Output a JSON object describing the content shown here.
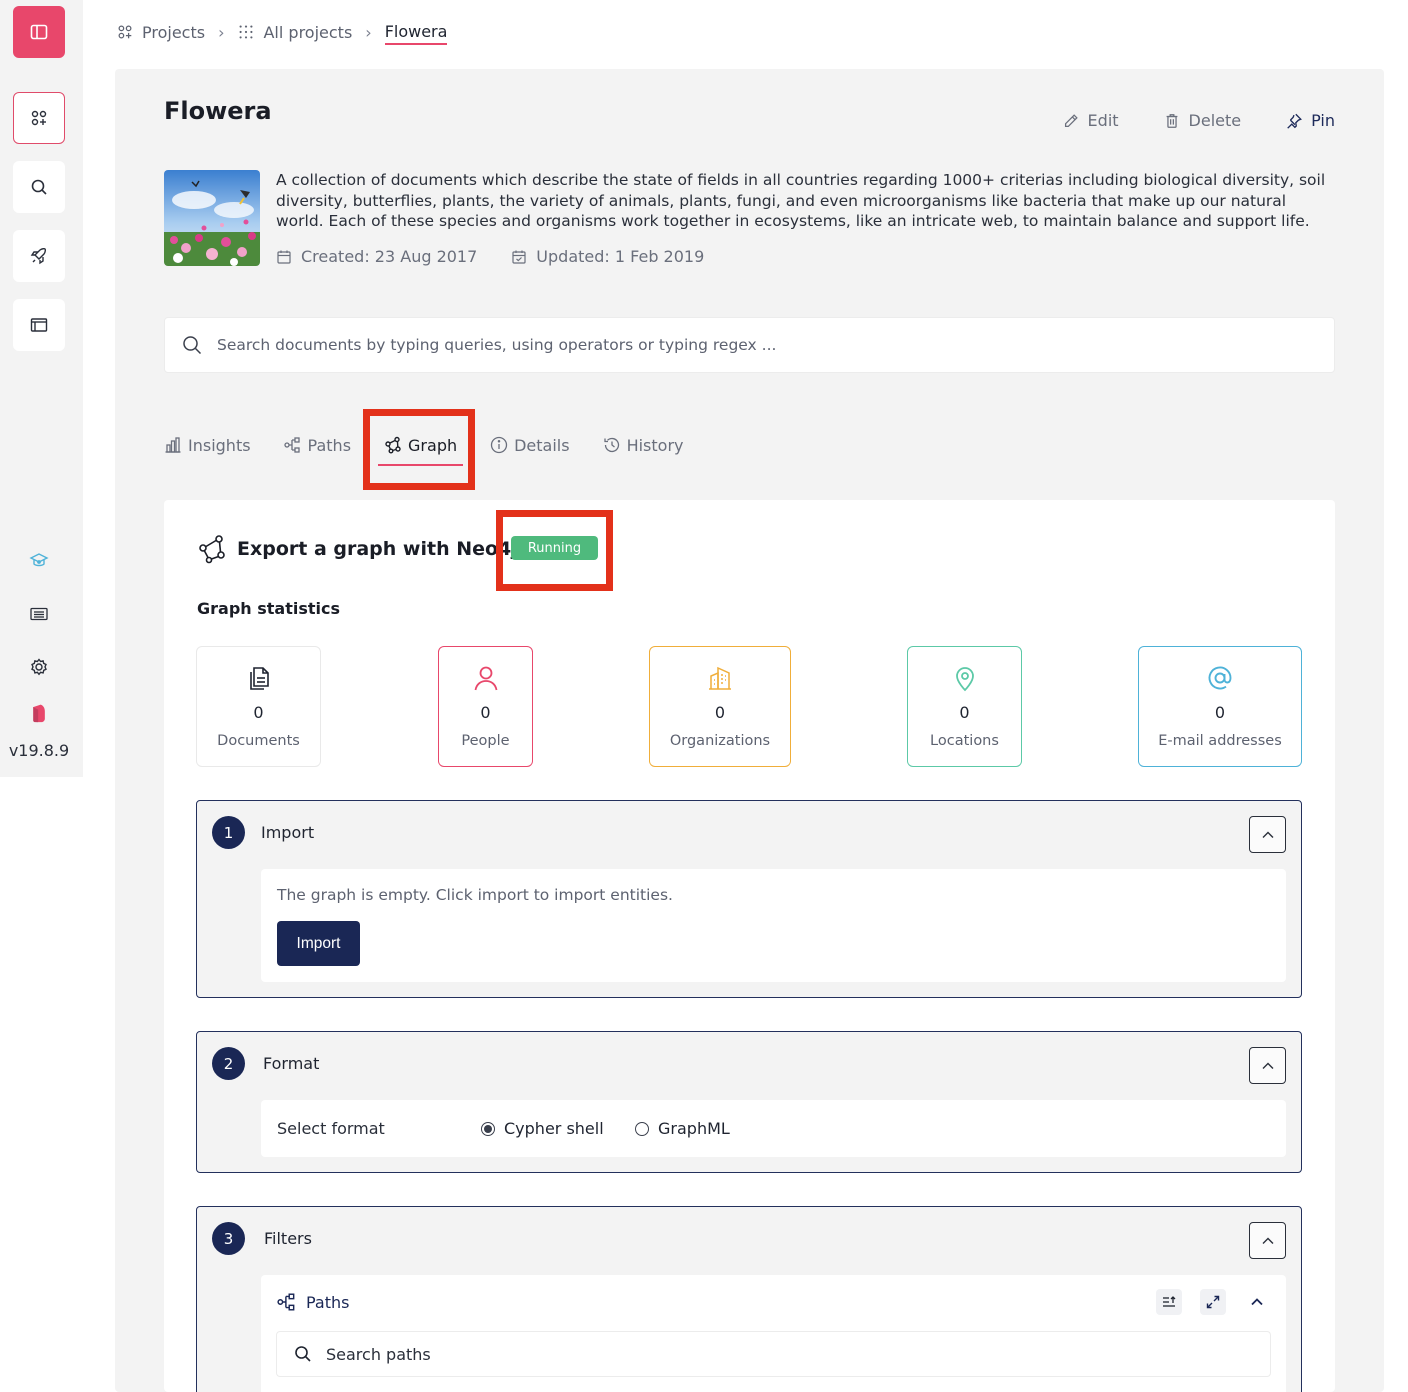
{
  "app": {
    "version": "v19.8.9"
  },
  "breadcrumb": [
    {
      "label": "Projects"
    },
    {
      "label": "All projects"
    },
    {
      "label": "Flowera"
    }
  ],
  "project": {
    "title": "Flowera",
    "description": "A collection of documents which describe the state of fields in all countries regarding 1000+ criterias including biological diversity, soil diversity, butterflies, plants, the variety of animals, plants, fungi, and even microorganisms like bacteria that make up our natural world. Each of these species and organisms work together in ecosystems, like an intricate web, to maintain balance and support life.",
    "created": "Created: 23 Aug 2017",
    "updated": "Updated: 1 Feb 2019",
    "actions": {
      "edit": "Edit",
      "delete": "Delete",
      "pin": "Pin"
    }
  },
  "search": {
    "placeholder": "Search documents by typing queries, using operators or typing regex ..."
  },
  "tabs": [
    {
      "label": "Insights",
      "icon": "bar-chart-icon"
    },
    {
      "label": "Paths",
      "icon": "tree-icon"
    },
    {
      "label": "Graph",
      "icon": "graph-icon",
      "active": true
    },
    {
      "label": "Details",
      "icon": "info-icon"
    },
    {
      "label": "History",
      "icon": "history-icon"
    }
  ],
  "graph": {
    "title": "Export a graph with Neo4j",
    "status": "Running",
    "stats_title": "Graph statistics",
    "stats": [
      {
        "value": "0",
        "label": "Documents",
        "color": "#e6e6e6",
        "icon": "documents-icon"
      },
      {
        "value": "0",
        "label": "People",
        "color": "#e8476b",
        "icon": "person-icon"
      },
      {
        "value": "0",
        "label": "Organizations",
        "color": "#f0ae3a",
        "icon": "building-icon"
      },
      {
        "value": "0",
        "label": "Locations",
        "color": "#5cc9a7",
        "icon": "location-pin-icon"
      },
      {
        "value": "0",
        "label": "E-mail addresses",
        "color": "#4eb2d8",
        "icon": "at-icon"
      }
    ],
    "steps": {
      "import": {
        "number": "1",
        "label": "Import",
        "message": "The graph is empty. Click import to import entities.",
        "button": "Import"
      },
      "format": {
        "number": "2",
        "label": "Format",
        "select_label": "Select format",
        "options": [
          {
            "label": "Cypher shell",
            "selected": true
          },
          {
            "label": "GraphML",
            "selected": false
          }
        ]
      },
      "filters": {
        "number": "3",
        "label": "Filters",
        "paths_title": "Paths",
        "paths_search_placeholder": "Search paths"
      }
    }
  },
  "colors": {
    "accent": "#e8476b",
    "primary": "#1a2755",
    "running": "#4fba7d",
    "highlight": "#e3311a"
  }
}
